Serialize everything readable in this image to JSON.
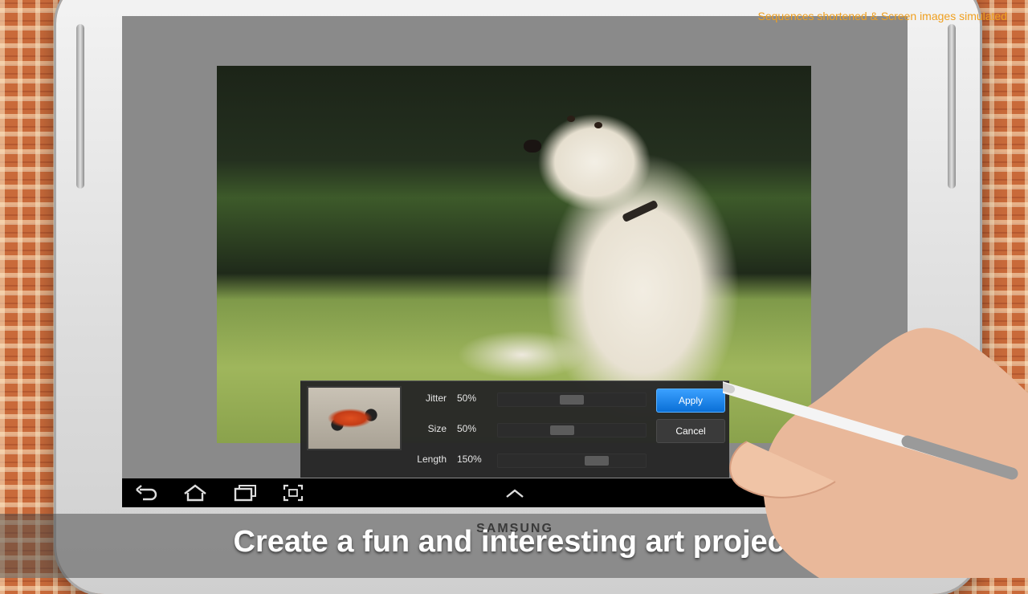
{
  "overlay": {
    "disclaimer": "Sequences shortened & Screen images simulated",
    "caption": "Create a fun and interesting art project",
    "brand": "SAMSUNG"
  },
  "photo": {
    "subject": "dog-photo"
  },
  "filter_panel": {
    "sliders": [
      {
        "label": "Jitter",
        "value_text": "50%",
        "value": 0.5
      },
      {
        "label": "Size",
        "value_text": "50%",
        "value": 0.42
      },
      {
        "label": "Length",
        "value_text": "150%",
        "value": 0.7
      }
    ],
    "apply_label": "Apply",
    "cancel_label": "Cancel"
  },
  "navbar": {
    "icons": [
      "back-icon",
      "home-icon",
      "recent-apps-icon",
      "screenshot-icon",
      "chevron-up-icon"
    ]
  },
  "colors": {
    "accent": "#0a6fd6",
    "disclaimer": "#f0a020"
  }
}
